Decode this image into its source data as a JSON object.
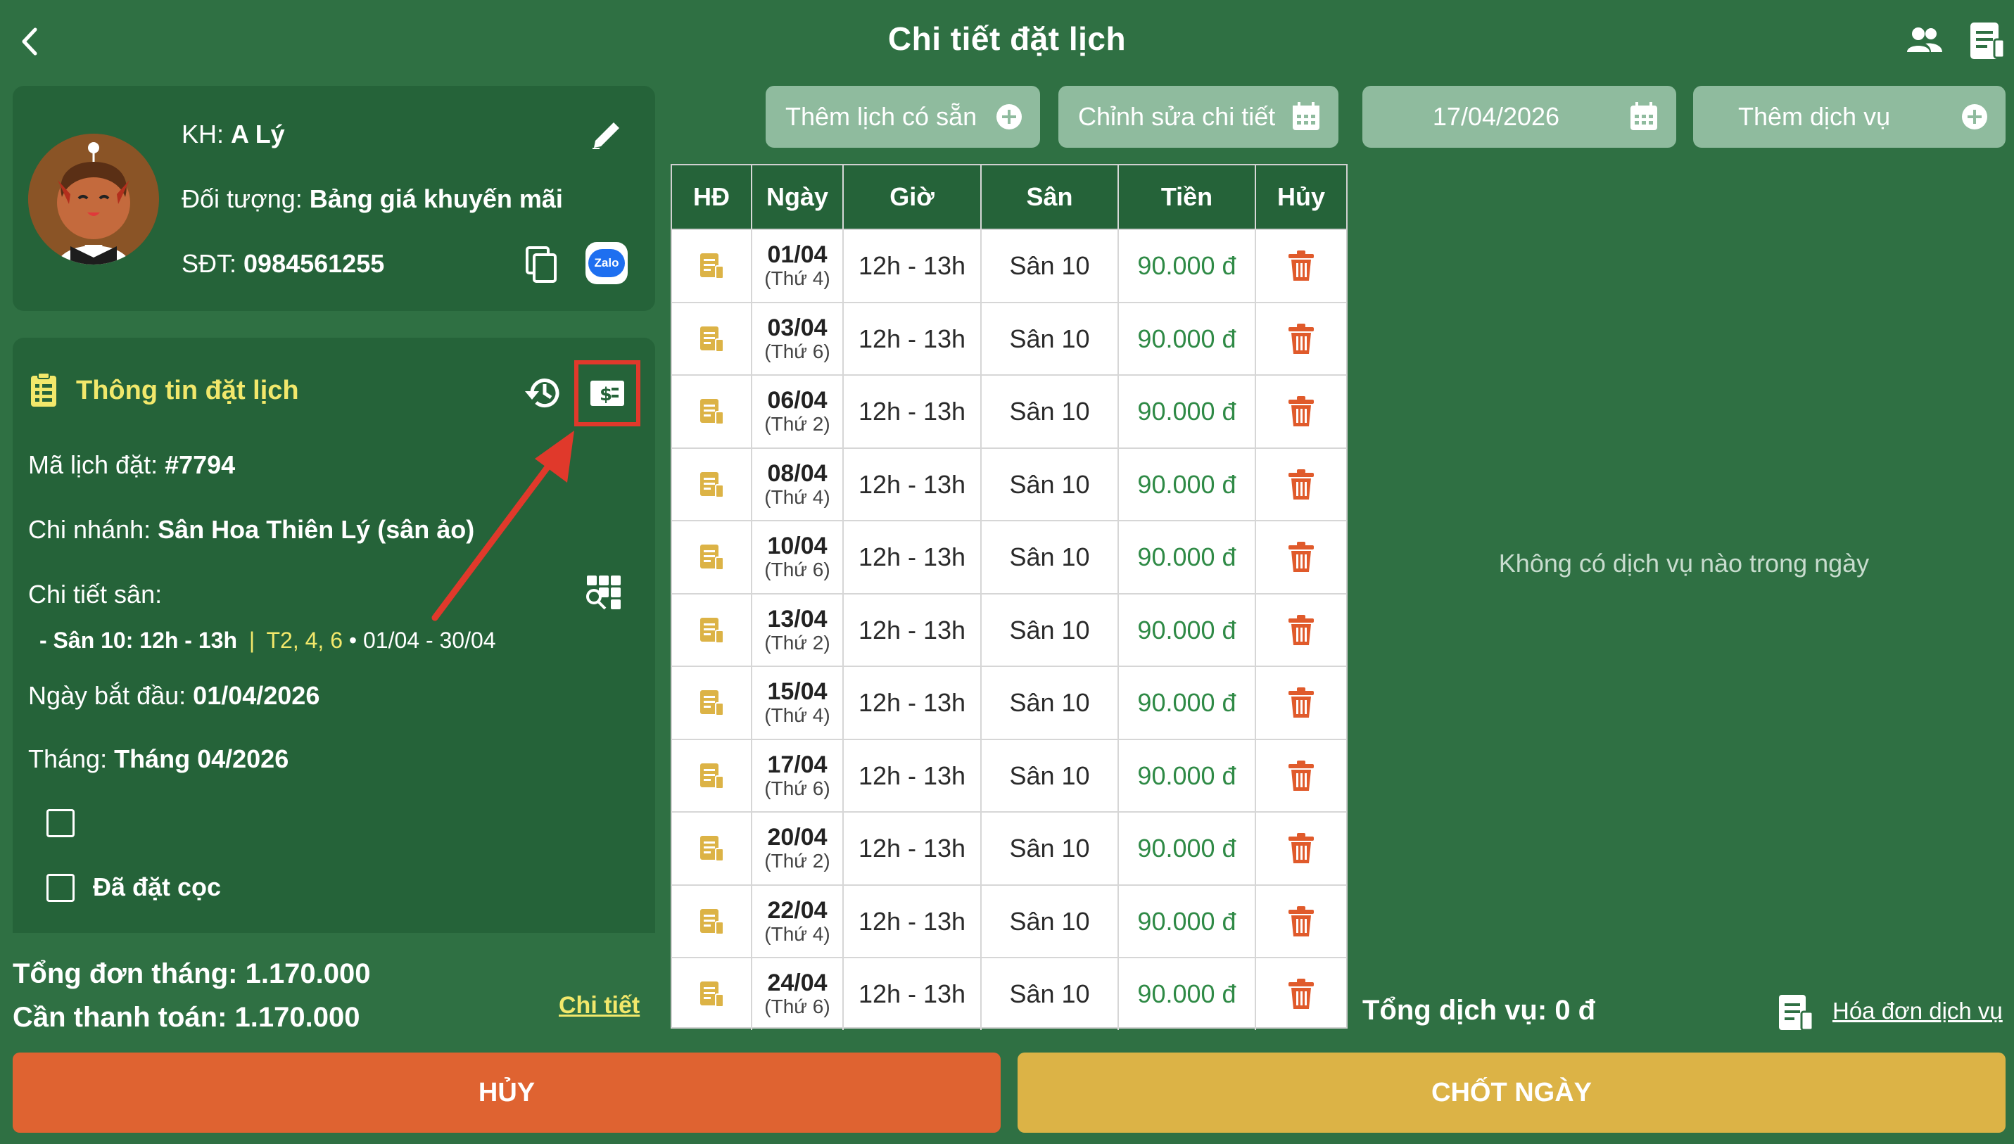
{
  "header": {
    "title": "Chi tiết đặt lịch",
    "back_icon": "chevron-left-icon",
    "right_icons": [
      "users-icon",
      "clipboard-icon"
    ]
  },
  "customer": {
    "name_label": "KH:",
    "name_value": "A Lý",
    "type_label": "Đối tượng:",
    "type_value": "Bảng giá khuyến mãi",
    "phone_label": "SĐT:",
    "phone_value": "0984561255",
    "zalo_label": "Zalo"
  },
  "booking_info": {
    "section_title": "Thông tin đặt lịch",
    "code_label": "Mã lịch đặt:",
    "code_value": "#7794",
    "branch_label": "Chi nhánh:",
    "branch_value": "Sân Hoa Thiên Lý (sân ảo)",
    "detail_label": "Chi tiết sân:",
    "detail_court": "- Sân 10: 12h - 13h",
    "detail_separator": "|",
    "detail_days": "T2, 4, 6",
    "detail_range": "• 01/04 - 30/04",
    "start_label": "Ngày bắt đầu:",
    "start_value": "01/04/2026",
    "month_label": "Tháng:",
    "month_value": "Tháng 04/2026",
    "checkbox1_label": "",
    "checkbox2_label": "Đã đặt cọc"
  },
  "totals": {
    "month_total_label": "Tổng đơn tháng:",
    "month_total_value": "1.170.000",
    "to_pay_label": "Cần thanh toán:",
    "to_pay_value": "1.170.000",
    "detail_link": "Chi tiết"
  },
  "toolbar": {
    "add_schedule": "Thêm lịch có sẵn",
    "edit_detail": "Chỉnh sửa chi tiết",
    "date": "17/04/2026",
    "add_service": "Thêm dịch vụ"
  },
  "table": {
    "headers": [
      "HĐ",
      "Ngày",
      "Giờ",
      "Sân",
      "Tiền",
      "Hủy"
    ],
    "rows": [
      {
        "date": "01/04",
        "weekday": "(Thứ 4)",
        "time": "12h - 13h",
        "court": "Sân 10",
        "price": "90.000 đ"
      },
      {
        "date": "03/04",
        "weekday": "(Thứ 6)",
        "time": "12h - 13h",
        "court": "Sân 10",
        "price": "90.000 đ"
      },
      {
        "date": "06/04",
        "weekday": "(Thứ 2)",
        "time": "12h - 13h",
        "court": "Sân 10",
        "price": "90.000 đ"
      },
      {
        "date": "08/04",
        "weekday": "(Thứ 4)",
        "time": "12h - 13h",
        "court": "Sân 10",
        "price": "90.000 đ"
      },
      {
        "date": "10/04",
        "weekday": "(Thứ 6)",
        "time": "12h - 13h",
        "court": "Sân 10",
        "price": "90.000 đ"
      },
      {
        "date": "13/04",
        "weekday": "(Thứ 2)",
        "time": "12h - 13h",
        "court": "Sân 10",
        "price": "90.000 đ"
      },
      {
        "date": "15/04",
        "weekday": "(Thứ 4)",
        "time": "12h - 13h",
        "court": "Sân 10",
        "price": "90.000 đ"
      },
      {
        "date": "17/04",
        "weekday": "(Thứ 6)",
        "time": "12h - 13h",
        "court": "Sân 10",
        "price": "90.000 đ"
      },
      {
        "date": "20/04",
        "weekday": "(Thứ 2)",
        "time": "12h - 13h",
        "court": "Sân 10",
        "price": "90.000 đ"
      },
      {
        "date": "22/04",
        "weekday": "(Thứ 4)",
        "time": "12h - 13h",
        "court": "Sân 10",
        "price": "90.000 đ"
      },
      {
        "date": "24/04",
        "weekday": "(Thứ 6)",
        "time": "12h - 13h",
        "court": "Sân 10",
        "price": "90.000 đ"
      }
    ]
  },
  "services": {
    "empty_text": "Không có dịch vụ nào trong ngày",
    "total_label": "Tổng dịch vụ:",
    "total_value": "0 đ",
    "invoice_link": "Hóa đơn dịch vụ"
  },
  "actions": {
    "cancel": "HỦY",
    "close_day": "CHỐT NGÀY"
  },
  "colors": {
    "background": "#2f7043",
    "panel": "#256339",
    "accent_yellow": "#f2e86b",
    "cancel": "#df6331",
    "confirm": "#dcb346",
    "highlight": "#e0392b",
    "trash": "#e05a2b",
    "invoice_icon": "#dcb346"
  }
}
